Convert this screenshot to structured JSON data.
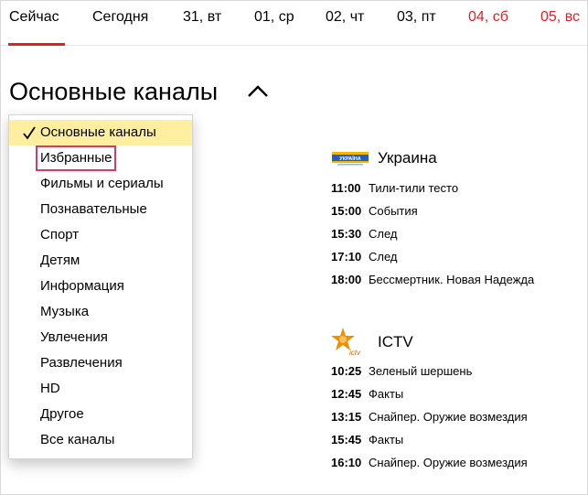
{
  "tabs": [
    {
      "label": "Сейчас",
      "weekend": false,
      "active": true
    },
    {
      "label": "Сегодня",
      "weekend": false,
      "active": false
    },
    {
      "label": "31, вт",
      "weekend": false,
      "active": false
    },
    {
      "label": "01, ср",
      "weekend": false,
      "active": false
    },
    {
      "label": "02, чт",
      "weekend": false,
      "active": false
    },
    {
      "label": "03, пт",
      "weekend": false,
      "active": false
    },
    {
      "label": "04, сб",
      "weekend": true,
      "active": false
    },
    {
      "label": "05, вс",
      "weekend": true,
      "active": false
    }
  ],
  "section": {
    "title": "Основные каналы"
  },
  "menu": {
    "items": [
      {
        "label": "Основные каналы",
        "selected": true
      },
      {
        "label": "Избранные",
        "highlighted": true
      },
      {
        "label": "Фильмы и сериалы"
      },
      {
        "label": "Познавательные"
      },
      {
        "label": "Спорт"
      },
      {
        "label": "Детям"
      },
      {
        "label": "Информация"
      },
      {
        "label": "Музыка"
      },
      {
        "label": "Увлечения"
      },
      {
        "label": "Развлечения"
      },
      {
        "label": "HD"
      },
      {
        "label": "Другое"
      },
      {
        "label": "Все каналы"
      }
    ]
  },
  "channels": [
    {
      "name": "Украина",
      "logo_text": "УКРАЇНА",
      "programs": [
        {
          "time": "11:00",
          "title": "Тили-тили тесто"
        },
        {
          "time": "15:00",
          "title": "События"
        },
        {
          "time": "15:30",
          "title": "След"
        },
        {
          "time": "17:10",
          "title": "След"
        },
        {
          "time": "18:00",
          "title": "Бессмертник. Новая Надежда"
        }
      ]
    },
    {
      "name": "ICTV",
      "logo_text": "ictv",
      "programs": [
        {
          "time": "10:25",
          "title": "Зеленый шершень"
        },
        {
          "time": "12:45",
          "title": "Факты"
        },
        {
          "time": "13:15",
          "title": "Снайпер. Оружие возмездия"
        },
        {
          "time": "15:45",
          "title": "Факты"
        },
        {
          "time": "16:10",
          "title": "Снайпер. Оружие возмездия"
        }
      ]
    }
  ],
  "colors": {
    "accent": "#e31e24",
    "selected_bg": "#fdeea0",
    "highlight_outline": "#d63a6a"
  }
}
